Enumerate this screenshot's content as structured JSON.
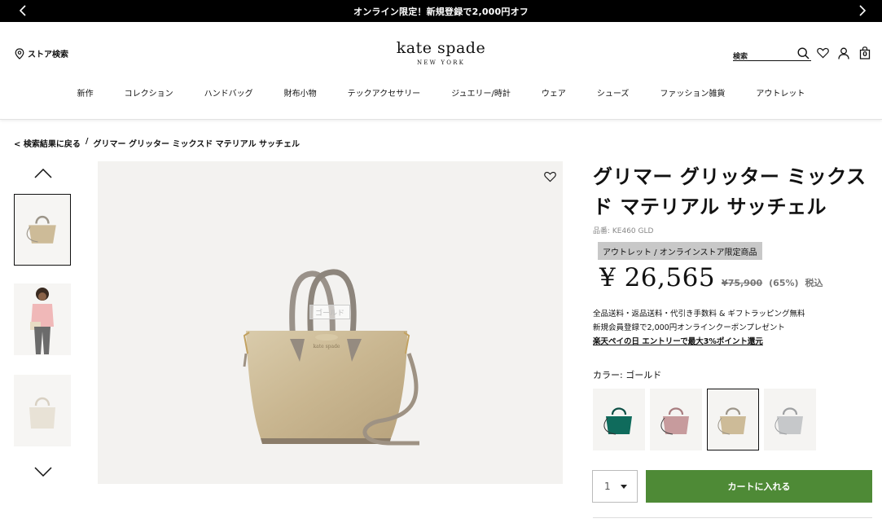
{
  "promo": {
    "text": "オンライン限定！新規登録で2,000円オフ"
  },
  "header": {
    "store_label": "ストア検索",
    "logo_brand": "kate spade",
    "logo_sub": "NEW YORK",
    "search_placeholder": "検索",
    "cart_count": "0"
  },
  "nav": [
    "新作",
    "コレクション",
    "ハンドバッグ",
    "財布小物",
    "テックアクセサリー",
    "ジュエリー/時計",
    "ウェア",
    "シューズ",
    "ファッション雑貨",
    "アウトレット"
  ],
  "breadcrumb": {
    "back": "< 検索結果に戻る",
    "sep": "/",
    "current": "グリマー グリッター ミックスド マテリアル サッチェル"
  },
  "product": {
    "title": "グリマー グリッター ミックスド マテリアル サッチェル",
    "sku": "品番: KE460 GLD",
    "badge": "アウトレット / オンラインストア限定商品",
    "price": "¥ 26,565",
    "original_price": "¥75,900",
    "discount": "(65%)",
    "tax": "税込",
    "perk1": "全品送料・返品送料・代引き手数料 & ギフトラッピング無料",
    "perk2": "新規会員登録で2,000円オンラインクーポンプレゼント",
    "perk3": "楽天ペイの日 エントリーで最大3%ポイント還元",
    "color_label": "カラー: ゴールド",
    "watermark": "ゴールド",
    "qty": "1",
    "cart_button": "カートに入れる"
  },
  "colors": {
    "cart_green": "#4e8a36",
    "gold": "#cdbb98",
    "teal": "#0f6b5c",
    "rose": "#c79b9d",
    "silver": "#c6c8ca",
    "cream": "#e8e2d6"
  }
}
